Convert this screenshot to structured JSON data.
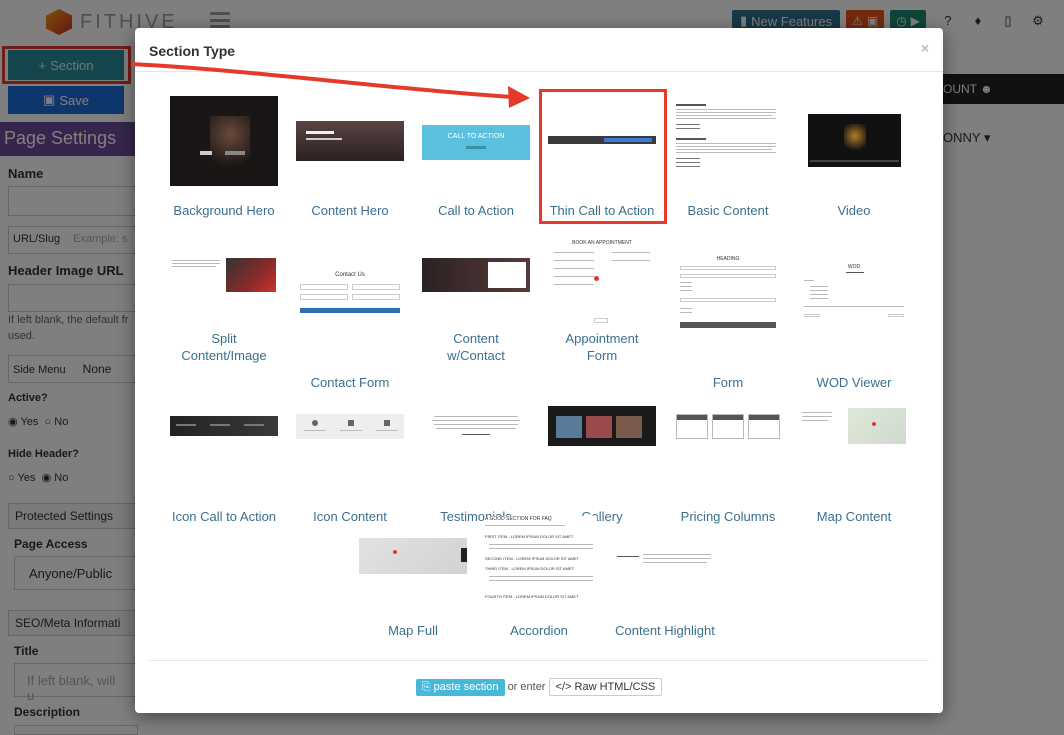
{
  "app": {
    "logo_text": "FITHIVE",
    "new_features_label": "New Features",
    "account_label": "OUNT",
    "user_label": "ONNY"
  },
  "sidebar": {
    "section_button": "Section",
    "save_button": "Save",
    "page_settings_title": "Page Settings",
    "name_label": "Name",
    "url_slug_label": "URL/Slug",
    "url_slug_placeholder": "Example: s",
    "header_image_label": "Header Image URL",
    "header_image_help": "If left blank, the default fr",
    "header_image_help2": "used.",
    "side_menu_label": "Side Menu",
    "side_menu_value": "None",
    "active_label": "Active?",
    "yes_label": "Yes",
    "no_label": "No",
    "hide_header_label": "Hide Header?",
    "protected_settings_label": "Protected Settings",
    "page_access_label": "Page Access",
    "page_access_value": "Anyone/Public",
    "seo_label": "SEO/Meta Informati",
    "title_label": "Title",
    "title_placeholder": "If left blank, will u",
    "description_label": "Description"
  },
  "modal": {
    "title": "Section Type",
    "close": "×",
    "tiles": [
      {
        "label": "Background Hero"
      },
      {
        "label": "Content Hero"
      },
      {
        "label": "Call to Action"
      },
      {
        "label": "Thin Call to Action"
      },
      {
        "label": "Basic Content"
      },
      {
        "label": "Video"
      },
      {
        "label": "Split Content/Image"
      },
      {
        "label": "Contact Form"
      },
      {
        "label": "Content w/Contact"
      },
      {
        "label": "Appointment Form"
      },
      {
        "label": "Form"
      },
      {
        "label": "WOD Viewer"
      },
      {
        "label": "Icon Call to Action"
      },
      {
        "label": "Icon Content"
      },
      {
        "label": "Testimonials"
      },
      {
        "label": "Gallery"
      },
      {
        "label": "Pricing Columns"
      },
      {
        "label": "Map Content"
      },
      {
        "label": "Map Full"
      },
      {
        "label": "Accordion"
      },
      {
        "label": "Content Highlight"
      }
    ],
    "thumb_text": {
      "call_to_action": "CALL TO ACTION",
      "book_appointment": "BOOK AN APPOINTMENT",
      "contact_us": "Contact Us",
      "heading": "HEADING",
      "wod": "WOD",
      "accordion_title": "A GOOD SECTION FOR FAQ",
      "accordion_items": [
        "FIRST ITEM - LOREM IPSUM DOLOR SIT AMET",
        "SECOND ITEM - LOREM IPSUM DOLOR SIT AMET",
        "THIRD ITEM - LOREM IPSUM DOLOR SIT AMET",
        "FOURTH ITEM - LOREM IPSUM DOLOR SIT AMET"
      ]
    },
    "footer": {
      "paste_label": "paste section",
      "or_enter": "or enter",
      "raw_label": "Raw HTML/CSS"
    }
  },
  "colors": {
    "accent_purple": "#6c4a9a",
    "section_teal": "#2a8a9a",
    "save_blue": "#1a6ed8",
    "highlight_red": "#e53a2a",
    "tile_label": "#3a6f8f"
  }
}
